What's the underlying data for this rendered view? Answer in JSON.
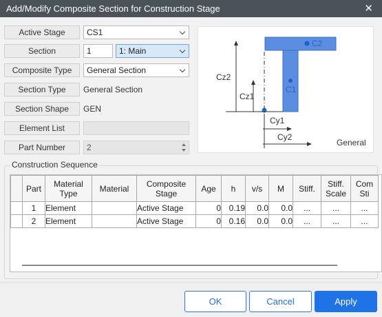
{
  "window": {
    "title": "Add/Modify Composite Section for Construction Stage",
    "close_icon": "close-icon"
  },
  "form": {
    "active_stage": {
      "label": "Active Stage",
      "value": "CS1"
    },
    "section": {
      "label": "Section",
      "number": "1",
      "selection": "1: Main"
    },
    "composite_type": {
      "label": "Composite Type",
      "value": "General Section"
    },
    "section_type": {
      "label": "Section Type",
      "value": "General Section"
    },
    "section_shape": {
      "label": "Section Shape",
      "value": "GEN"
    },
    "element_list": {
      "label": "Element List",
      "value": ""
    },
    "part_number": {
      "label": "Part Number",
      "value": "2"
    }
  },
  "preview": {
    "labels": {
      "c1": "C1",
      "c2": "C2",
      "cz1": "Cz1",
      "cz2": "Cz2",
      "cy1": "Cy1",
      "cy2": "Cy2"
    },
    "caption": "General"
  },
  "sequence": {
    "title": "Construction Sequence",
    "headers": [
      "Part",
      "Material Type",
      "Material",
      "Composite Stage",
      "Age",
      "h",
      "v/s",
      "M",
      "Stiff.",
      "Stiff. Scale",
      "Com Sti"
    ],
    "rows": [
      {
        "part": "1",
        "material_type": "Element",
        "material": "",
        "composite_stage": "Active Stage",
        "age": "0",
        "h": "0.19",
        "vs": "0.0",
        "m": "0.0",
        "stiff": "...",
        "stiff_scale": "...",
        "comp_stiff": "..."
      },
      {
        "part": "2",
        "material_type": "Element",
        "material": "",
        "composite_stage": "Active Stage",
        "age": "0",
        "h": "0.16",
        "vs": "0.0",
        "m": "0.0",
        "stiff": "...",
        "stiff_scale": "...",
        "comp_stiff": "..."
      }
    ]
  },
  "buttons": {
    "ok": "OK",
    "cancel": "Cancel",
    "apply": "Apply"
  },
  "colors": {
    "accent": "#1f73e6",
    "section_fill": "#5b8ee0",
    "titlebar": "#4b525a"
  }
}
